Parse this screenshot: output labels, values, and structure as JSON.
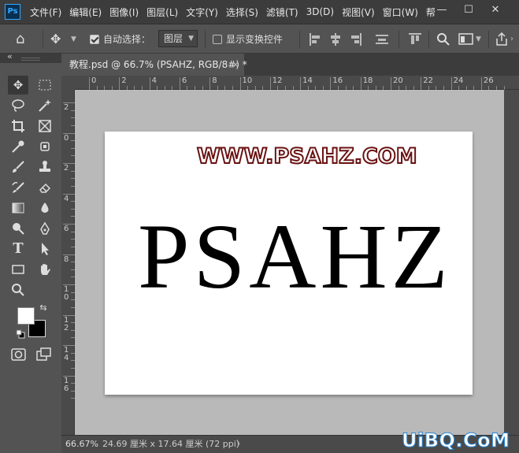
{
  "app": {
    "logo": "Ps"
  },
  "menu": [
    "文件(F)",
    "编辑(E)",
    "图像(I)",
    "图层(L)",
    "文字(Y)",
    "选择(S)",
    "滤镜(T)",
    "3D(D)",
    "视图(V)",
    "窗口(W)",
    "帮"
  ],
  "window_controls": {
    "minimize": "—",
    "restore": "☐",
    "close": "✕"
  },
  "options": {
    "home_icon": "⌂",
    "move_icon": "✥",
    "auto_select_label": "自动选择：",
    "auto_select_checked": true,
    "auto_select_target": "图层",
    "show_transform_label": "显示变换控件",
    "show_transform_checked": false
  },
  "toolbar": {
    "collapse": "«"
  },
  "document_tab": {
    "title": "教程.psd @ 66.7% (PSAHZ, RGB/8#) *",
    "close": "×"
  },
  "rulers": {
    "top_ticks": [
      "0",
      "2",
      "4",
      "6",
      "8",
      "10",
      "12",
      "14",
      "16",
      "18",
      "20",
      "22",
      "24",
      "26"
    ],
    "left_ticks": [
      "2",
      "0",
      "2",
      "4",
      "6",
      "8",
      "1\n0",
      "1\n2",
      "1\n4",
      "1\n6"
    ]
  },
  "canvas": {
    "watermark_text": "WWW.PSAHZ.COM",
    "main_text": "PSAHZ"
  },
  "status": {
    "zoom": "66.67%",
    "doc_size": "24.69 厘米 x 17.64 厘米 (72 ppi)",
    "arrow": "〉"
  },
  "site_watermark": "UiBQ.CoM",
  "colors": {
    "foreground": "#ffffff",
    "background": "#000000",
    "watermark_stroke": "#6a1212"
  }
}
